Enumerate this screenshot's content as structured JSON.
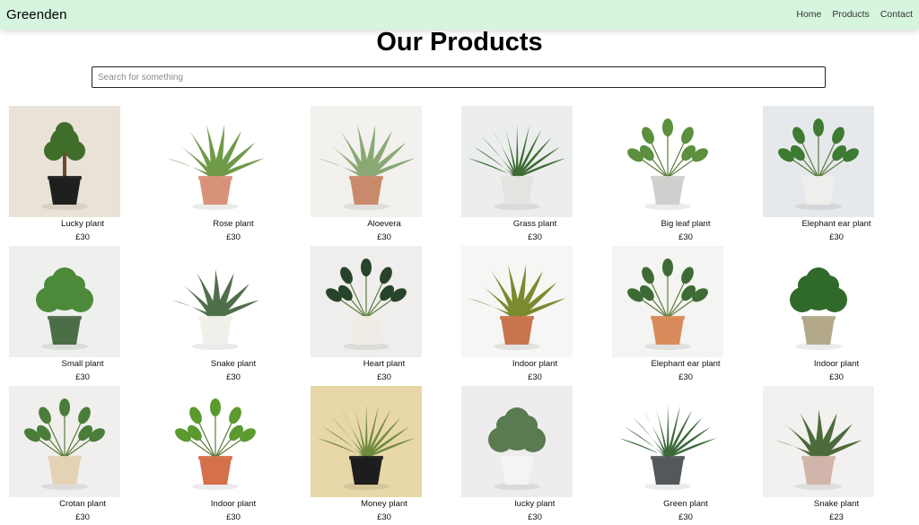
{
  "navbar": {
    "brand": "Greenden",
    "links": [
      {
        "label": "Home"
      },
      {
        "label": "Products"
      },
      {
        "label": "Contact"
      }
    ]
  },
  "page": {
    "title": "Our Products"
  },
  "search": {
    "placeholder": "Search for something",
    "value": ""
  },
  "products": [
    {
      "name": "Lucky plant",
      "price": "£30",
      "bg": "#e9e2d6",
      "pot": "#1f1f1f",
      "leaf": "#3f6e2a",
      "style": "bonsai"
    },
    {
      "name": "Rose plant",
      "price": "£30",
      "bg": "#ffffff",
      "pot": "#d9927a",
      "leaf": "#6f9a4a",
      "style": "aloe"
    },
    {
      "name": "Aloevera",
      "price": "£30",
      "bg": "#f2f1ee",
      "pot": "#c98a6c",
      "leaf": "#8aa874",
      "style": "aloe"
    },
    {
      "name": "Grass plant",
      "price": "£30",
      "bg": "#eceeee",
      "pot": "#e3e3e0",
      "leaf": "#3e6b35",
      "style": "grass"
    },
    {
      "name": "Big leaf plant",
      "price": "£30",
      "bg": "#ffffff",
      "pot": "#cfcfcd",
      "leaf": "#5c8f3e",
      "style": "bigleaf"
    },
    {
      "name": "Elephant ear plant",
      "price": "£30",
      "bg": "#e6e9ec",
      "pot": "#eeeeec",
      "leaf": "#3d7a32",
      "style": "elephant"
    },
    {
      "name": "Small plant",
      "price": "£30",
      "bg": "#eef0ee",
      "pot": "#4b6e47",
      "leaf": "#4c8a3a",
      "style": "fern"
    },
    {
      "name": "Snake plant",
      "price": "£30",
      "bg": "#ffffff",
      "pot": "#f1efe9",
      "leaf": "#4f6e4a",
      "style": "snake"
    },
    {
      "name": "Heart plant",
      "price": "£30",
      "bg": "#efeeec",
      "pot": "#efece6",
      "leaf": "#27442a",
      "style": "bigleaf"
    },
    {
      "name": "Indoor plant",
      "price": "£30",
      "bg": "#f6f6f4",
      "pot": "#c8744e",
      "leaf": "#7a8a2e",
      "style": "aloe"
    },
    {
      "name": "Elephant ear plant",
      "price": "£30",
      "bg": "#f4f4f2",
      "pot": "#d98a5a",
      "leaf": "#3e6b35",
      "style": "elephant"
    },
    {
      "name": "Indoor plant",
      "price": "£30",
      "bg": "#ffffff",
      "pot": "#b3a88a",
      "leaf": "#2f6a2a",
      "style": "fern"
    },
    {
      "name": "Crotan plant",
      "price": "£30",
      "bg": "#f0efed",
      "pot": "#e3d2b4",
      "leaf": "#4a7d3a",
      "style": "bigleaf"
    },
    {
      "name": "Indoor plant",
      "price": "£30",
      "bg": "#ffffff",
      "pot": "#d4704a",
      "leaf": "#5a9a2e",
      "style": "pothos"
    },
    {
      "name": "Money plant",
      "price": "£30",
      "bg": "#e8d7a8",
      "pot": "#1d1d1d",
      "leaf": "#6f8a3e",
      "style": "grass"
    },
    {
      "name": "lucky plant",
      "price": "£30",
      "bg": "#ededed",
      "pot": "#f4f4f4",
      "leaf": "#5a7a52",
      "style": "succulent"
    },
    {
      "name": "Green plant",
      "price": "£30",
      "bg": "#ffffff",
      "pot": "#55585b",
      "leaf": "#3d6a3a",
      "style": "grass"
    },
    {
      "name": "Snake plant",
      "price": "£23",
      "bg": "#f2f1ef",
      "pot": "#d2b5aa",
      "leaf": "#4d6a3a",
      "style": "snake"
    }
  ]
}
